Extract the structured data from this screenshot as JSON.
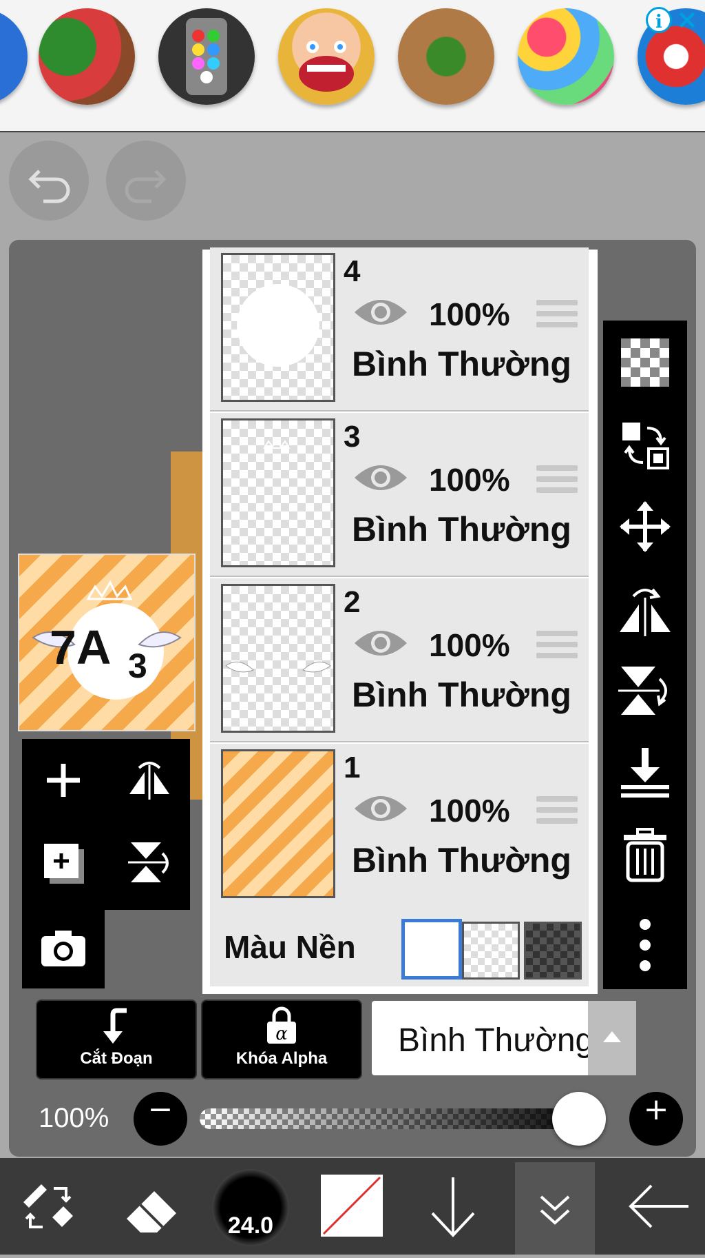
{
  "ad": {
    "games": [
      "watermelon-slice-game",
      "color-balls-sort-game",
      "dentist-game",
      "frog-bubble-game",
      "bubble-shooter-game",
      "pool-ball-game"
    ]
  },
  "toolbar": {
    "undo": "undo",
    "redo": "redo"
  },
  "layers": [
    {
      "number": "4",
      "opacity": "100%",
      "blend": "Bình Thường",
      "thumb": "white-circle"
    },
    {
      "number": "3",
      "opacity": "100%",
      "blend": "Bình Thường",
      "thumb": "faint-crown"
    },
    {
      "number": "2",
      "opacity": "100%",
      "blend": "Bình Thường",
      "thumb": "wings"
    },
    {
      "number": "1",
      "opacity": "100%",
      "blend": "Bình Thường",
      "thumb": "orange-stripes"
    }
  ],
  "background": {
    "label": "Màu Nền",
    "selected": "white"
  },
  "actions": {
    "clip_label": "Cắt Đoạn",
    "alpha_lock_label": "Khóa Alpha"
  },
  "blend_mode": {
    "value": "Bình Thường"
  },
  "opacity": {
    "label": "100%",
    "value": 1.0
  },
  "brush": {
    "size": "24.0"
  },
  "colors": {
    "accent": "#3a7bd5",
    "stripe_dark": "#f5a94a",
    "stripe_light": "#ffdba6"
  }
}
